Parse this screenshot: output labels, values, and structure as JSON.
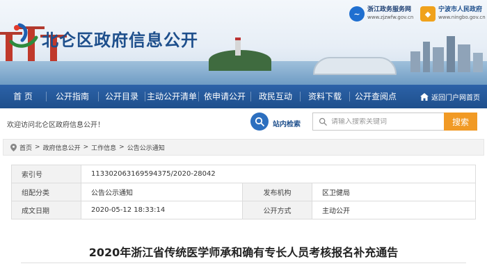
{
  "header": {
    "site_title": "北仑区政府信息公开",
    "partner1": {
      "name": "浙江政务服务网",
      "url": "www.zjzwfw.gov.cn"
    },
    "partner2": {
      "name": "宁波市人民政府",
      "url": "www.ningbo.gov.cn"
    }
  },
  "nav": {
    "items": [
      "首 页",
      "公开指南",
      "公开目录",
      "主动公开清单",
      "依申请公开",
      "政民互动",
      "资料下载",
      "公开查阅点"
    ],
    "back_label": "返回门户网首页"
  },
  "welcome_text": "欢迎访问北仑区政府信息公开！",
  "site_search_label": "站内检索",
  "search": {
    "placeholder": "请输入搜索关键词",
    "button_label": "搜索"
  },
  "breadcrumb": [
    "首页",
    "政府信息公开",
    "工作信息",
    "公告公示通知"
  ],
  "meta": {
    "index_label": "索引号",
    "index_value": "113302063169594375/2020-28042",
    "category_label": "组配分类",
    "category_value": "公告公示通知",
    "publisher_label": "发布机构",
    "publisher_value": "区卫健局",
    "date_label": "成文日期",
    "date_value": "2020-05-12 18:33:14",
    "method_label": "公开方式",
    "method_value": "主动公开"
  },
  "article_title": "2020年浙江省传统医学师承和确有专长人员考核报名补充通告",
  "colors": {
    "nav_blue": "#1e4f8c",
    "search_orange": "#f19a25",
    "title_blue": "#1e4f8c"
  }
}
